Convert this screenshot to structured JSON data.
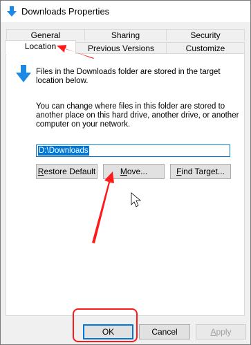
{
  "window": {
    "title": "Downloads Properties"
  },
  "tabs": {
    "row1": [
      {
        "label": "General"
      },
      {
        "label": "Sharing"
      },
      {
        "label": "Security"
      }
    ],
    "row2": [
      {
        "label": "Location"
      },
      {
        "label": "Previous Versions"
      },
      {
        "label": "Customize"
      }
    ]
  },
  "location": {
    "info_line1": "Files in the Downloads folder are stored in the target",
    "info_line2": "location below.",
    "desc_line1": "You can change where files in this folder are stored to",
    "desc_line2": "another place on this hard drive, another drive, or another",
    "desc_line3": "computer on your network.",
    "path_value": "D:\\Downloads",
    "restore_default": {
      "pre": "",
      "ul": "R",
      "post": "estore Default"
    },
    "move": {
      "pre": "",
      "ul": "M",
      "post": "ove..."
    },
    "find_target": {
      "pre": "",
      "ul": "F",
      "post": "ind Target..."
    }
  },
  "footer": {
    "ok": "OK",
    "cancel": "Cancel",
    "apply": {
      "pre": "",
      "ul": "A",
      "post": "pply"
    }
  },
  "colors": {
    "accent": "#0078d7",
    "arrow": "#ff1a1a"
  }
}
